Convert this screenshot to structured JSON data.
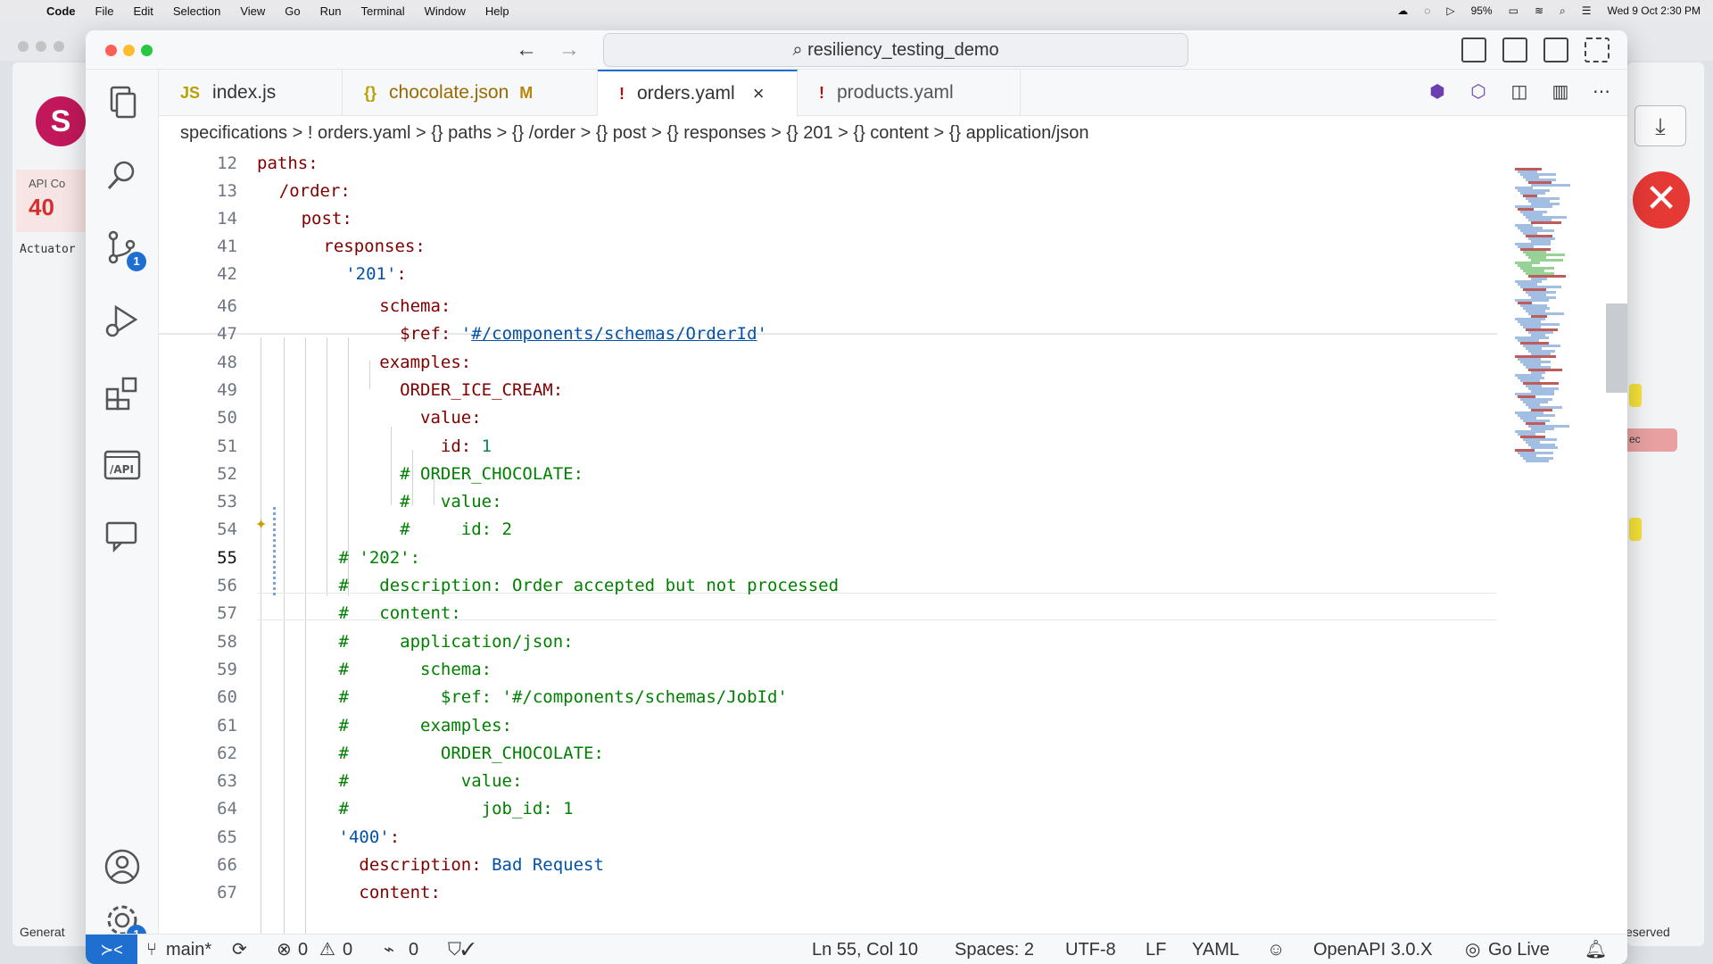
{
  "menubar": {
    "items": [
      "Code",
      "File",
      "Edit",
      "Selection",
      "View",
      "Go",
      "Run",
      "Terminal",
      "Window",
      "Help"
    ],
    "battery": "95%",
    "datetime": "Wed 9 Oct 2:30 PM"
  },
  "background": {
    "api_cov_label": "API Co",
    "api_cov_value": "40",
    "actuator": "Actuator",
    "generate": "Generat",
    "reserved": "eserved",
    "pink_tag": "ec"
  },
  "window": {
    "search": "resiliency_testing_demo"
  },
  "tabs": [
    {
      "icon": "JS",
      "label": "index.js",
      "modified": ""
    },
    {
      "icon": "{}",
      "label": "chocolate.json",
      "modified": "M"
    },
    {
      "icon": "!",
      "label": "orders.yaml",
      "modified": ""
    },
    {
      "icon": "!",
      "label": "products.yaml",
      "modified": ""
    }
  ],
  "breadcrumb": "specifications  >  !  orders.yaml  >  {} paths  >  {} /order  >  {} post  >  {} responses  >  {} 201  >  {} content  >  {} application/json",
  "sticky_lines": [
    {
      "n": "12",
      "text": "paths:",
      "indent": 0
    },
    {
      "n": "13",
      "text": "/order:",
      "indent": 1
    },
    {
      "n": "14",
      "text": "post:",
      "indent": 2
    },
    {
      "n": "41",
      "text": "responses:",
      "indent": 3
    },
    {
      "n": "42",
      "text": "'201':",
      "indent": 4
    }
  ],
  "code_lines": [
    {
      "n": "46",
      "pre": "            ",
      "key": "schema:",
      "rest": ""
    },
    {
      "n": "47",
      "pre": "              ",
      "key": "$ref: ",
      "rest": "'#/components/schemas/OrderId'"
    },
    {
      "n": "48",
      "pre": "            ",
      "key": "examples:",
      "rest": ""
    },
    {
      "n": "49",
      "pre": "              ",
      "key": "ORDER_ICE_CREAM:",
      "rest": ""
    },
    {
      "n": "50",
      "pre": "                ",
      "key": "value:",
      "rest": ""
    },
    {
      "n": "51",
      "pre": "                  ",
      "key": "id: ",
      "rest": "1"
    },
    {
      "n": "52",
      "pre": "              ",
      "com": "# ORDER_CHOCOLATE:"
    },
    {
      "n": "53",
      "pre": "              ",
      "com": "#   value:"
    },
    {
      "n": "54",
      "pre": "              ",
      "com": "#     id: 2"
    },
    {
      "n": "55",
      "pre": "        ",
      "com": "# '202':"
    },
    {
      "n": "56",
      "pre": "        ",
      "com": "#   description: Order accepted but not processed"
    },
    {
      "n": "57",
      "pre": "        ",
      "com": "#   content:"
    },
    {
      "n": "58",
      "pre": "        ",
      "com": "#     application/json:"
    },
    {
      "n": "59",
      "pre": "        ",
      "com": "#       schema:"
    },
    {
      "n": "60",
      "pre": "        ",
      "com": "#         $ref: '#/components/schemas/JobId'"
    },
    {
      "n": "61",
      "pre": "        ",
      "com": "#       examples:"
    },
    {
      "n": "62",
      "pre": "        ",
      "com": "#         ORDER_CHOCOLATE:"
    },
    {
      "n": "63",
      "pre": "        ",
      "com": "#           value:"
    },
    {
      "n": "64",
      "pre": "        ",
      "com": "#             job_id: 1"
    },
    {
      "n": "65",
      "pre": "        ",
      "str": "'400'",
      "key": ":"
    },
    {
      "n": "66",
      "pre": "          ",
      "key": "description: ",
      "rest": "Bad Request"
    },
    {
      "n": "67",
      "pre": "          ",
      "key": "content:",
      "rest": ""
    }
  ],
  "status": {
    "branch": "main*",
    "errors": "0",
    "warnings": "0",
    "ports": "0",
    "position": "Ln 55, Col 10",
    "spaces": "Spaces: 2",
    "encoding": "UTF-8",
    "eol": "LF",
    "language": "YAML",
    "openapi": "OpenAPI 3.0.X",
    "golive": "Go Live"
  },
  "badges": {
    "scm": "1",
    "settings": "1"
  },
  "colors": {
    "accent": "#1f6fd1",
    "comment": "#008000",
    "key": "#800000",
    "string": "#0451a5",
    "number": "#098658"
  }
}
